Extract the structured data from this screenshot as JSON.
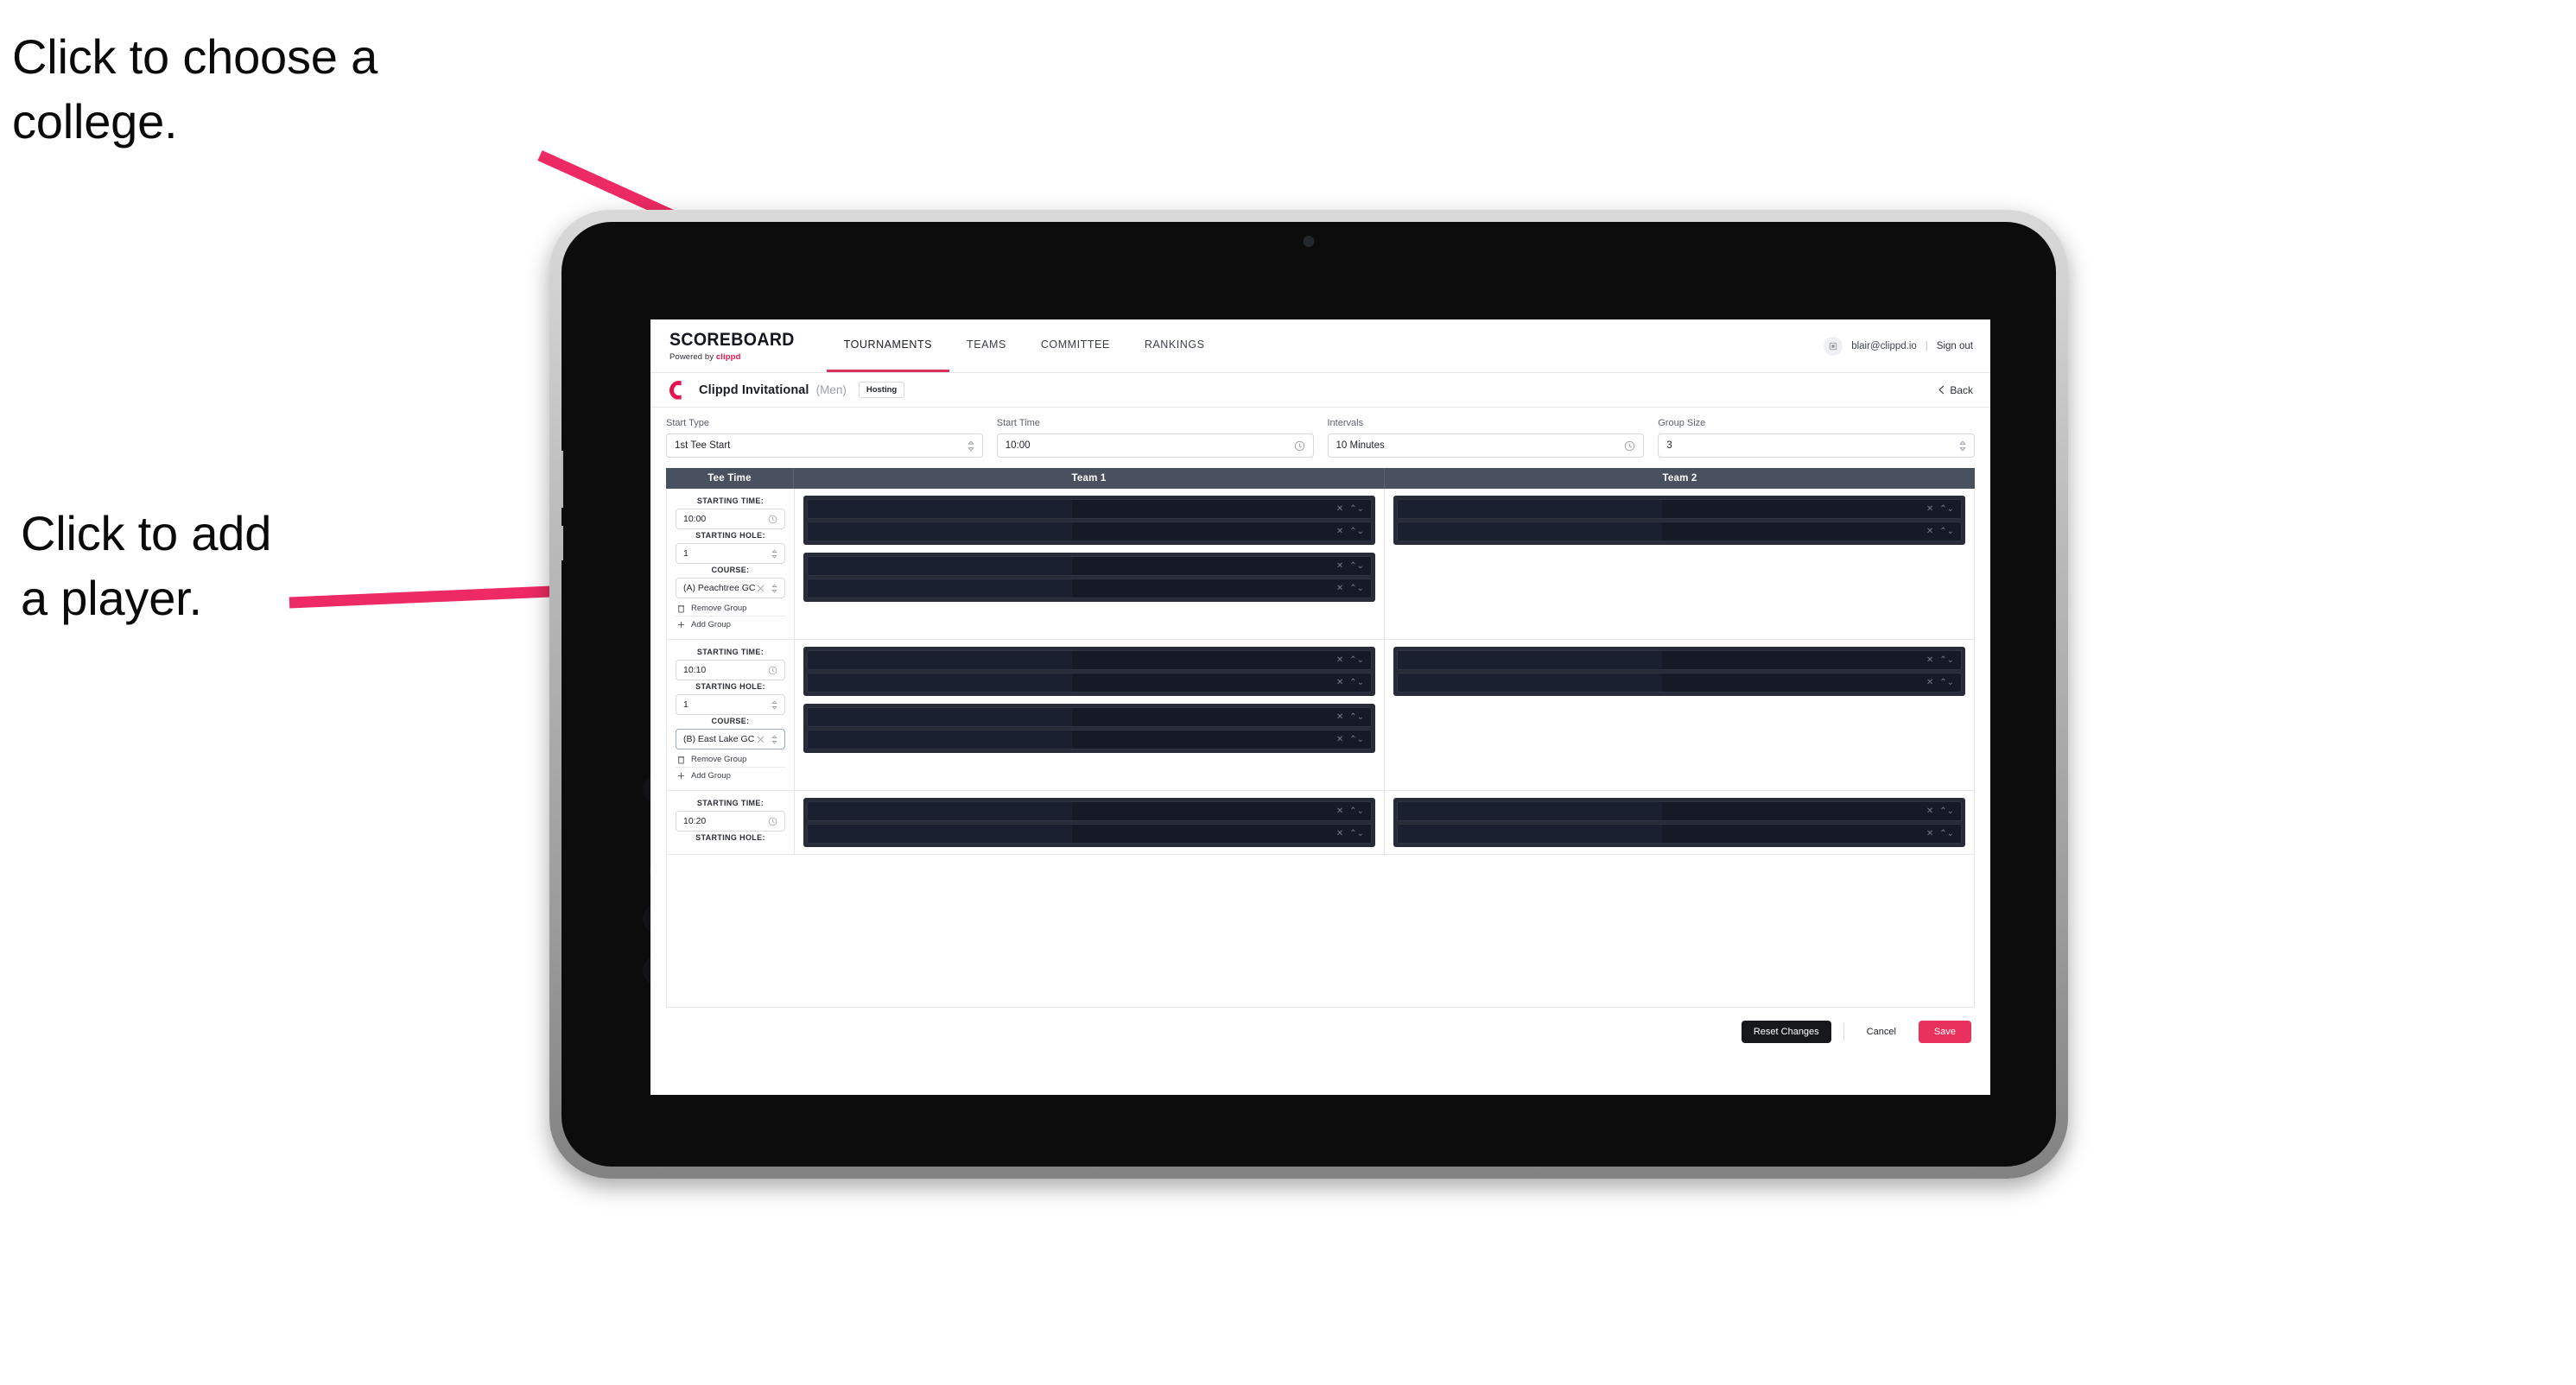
{
  "annotations": [
    {
      "id": "choose-college",
      "text": "Click to choose a\ncollege."
    },
    {
      "id": "add-player",
      "text": "Click to add\na player."
    }
  ],
  "colors": {
    "accent_pink": "#e8315c",
    "arrow_pink": "#ed2a63",
    "nav_active_underline": "#d8315b",
    "table_header_bg": "#49505f",
    "player_row_bg": "#161a26",
    "group_bg": "#272c38"
  },
  "topnav": {
    "brand_word": "SCOREBOARD",
    "brand_sub_prefix": "Powered by",
    "brand_sub_name": "clippd",
    "tabs": [
      {
        "label": "TOURNAMENTS",
        "active": true
      },
      {
        "label": "TEAMS",
        "active": false
      },
      {
        "label": "COMMITTEE",
        "active": false
      },
      {
        "label": "RANKINGS",
        "active": false
      }
    ],
    "account_icon": "user-avatar-icon",
    "email": "blair@clippd.io",
    "separator": "|",
    "sign_out": "Sign out"
  },
  "titlebar": {
    "logo_icon": "clippd-c-logo",
    "tournament_name": "Clippd Invitational",
    "gender": "(Men)",
    "badge": "Hosting",
    "back_icon": "chevron-left-icon",
    "back_label": "Back"
  },
  "controls": [
    {
      "label": "Start Type",
      "value": "1st Tee Start",
      "icon": "updown-chevrons-icon"
    },
    {
      "label": "Start Time",
      "value": "10:00",
      "icon": "clock-icon"
    },
    {
      "label": "Intervals",
      "value": "10 Minutes",
      "icon": "clock-icon"
    },
    {
      "label": "Group Size",
      "value": "3",
      "icon": "updown-chevrons-icon"
    }
  ],
  "table": {
    "headers": {
      "tee_time": "Tee Time",
      "team1": "Team 1",
      "team2": "Team 2"
    },
    "field_labels": {
      "starting_time": "STARTING TIME:",
      "starting_hole": "STARTING HOLE:",
      "course": "COURSE:"
    },
    "actions": {
      "remove_group": "Remove Group",
      "remove_icon": "trash-icon",
      "add_group": "Add Group",
      "add_icon": "plus-icon"
    },
    "row_icons": {
      "clear": "x-clear-icon",
      "stepper": "updown-chevrons-icon"
    },
    "rows": [
      {
        "starting_time": "10:00",
        "starting_hole": "1",
        "course": "(A) Peachtree GC",
        "course_focused": false,
        "team1_groups": [
          {
            "players": [
              "",
              ""
            ]
          },
          {
            "players": [
              "",
              ""
            ]
          }
        ],
        "team2_groups": [
          {
            "players": [
              "",
              ""
            ]
          }
        ]
      },
      {
        "starting_time": "10:10",
        "starting_hole": "1",
        "course": "(B) East Lake GC",
        "course_focused": true,
        "team1_groups": [
          {
            "players": [
              "",
              ""
            ]
          },
          {
            "players": [
              "",
              ""
            ]
          }
        ],
        "team2_groups": [
          {
            "players": [
              "",
              ""
            ]
          }
        ]
      },
      {
        "starting_time": "10:20",
        "starting_hole": "",
        "course": "",
        "course_focused": false,
        "team1_groups": [
          {
            "players": [
              "",
              ""
            ]
          }
        ],
        "team2_groups": [
          {
            "players": [
              "",
              ""
            ]
          }
        ]
      }
    ]
  },
  "footer": {
    "reset": "Reset Changes",
    "cancel": "Cancel",
    "save": "Save"
  }
}
